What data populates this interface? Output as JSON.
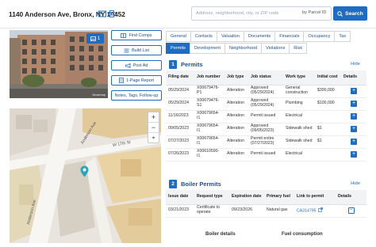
{
  "header": {
    "address": "1140 Anderson Ave, Bronx, NY 10452",
    "icons": [
      "envelope-icon",
      "printer-icon"
    ]
  },
  "search": {
    "placeholder": "Address, neighborhood, city, or ZIP code",
    "by_label": "by Parcel ID",
    "button_label": "Search"
  },
  "photo": {
    "count": "1",
    "caption": "Nearmap"
  },
  "actions": {
    "find_comps": "Find Comps",
    "build_list": "Build List",
    "post_ad": "Post Ad",
    "page_report": "1-Page Report",
    "notes": "Notes, Tags, Follow-up"
  },
  "map": {
    "streets": {
      "w170": "W 17th St",
      "anderson_upper": "Anderson Ave",
      "anderson_lower": "Anderson Ave"
    },
    "zoom_in": "+",
    "zoom_out": "−",
    "reset": "⌖"
  },
  "tabs": {
    "row1": [
      "General",
      "Contacts",
      "Valuation",
      "Documents",
      "Financials",
      "Occupancy",
      "Tax"
    ],
    "row2": [
      "Permits",
      "Development",
      "Neighborhood",
      "Violations",
      "Risk"
    ],
    "active": "Permits"
  },
  "permits": {
    "number": "1",
    "title": "Permits",
    "hide_label": "Hide",
    "columns": [
      "Filing date",
      "Job number",
      "Job type",
      "Job status",
      "Work type",
      "Initial cost",
      "Details"
    ],
    "rows": [
      [
        "05/29/2024",
        "X00679476-P1",
        "Alteration",
        "Approved (05/29/2024)",
        "General construction",
        "$300,000"
      ],
      [
        "05/29/2024",
        "X00679476-S1",
        "Alteration",
        "Approved (05/29/2024)",
        "Plumbing",
        "$100,000"
      ],
      [
        "11/16/2023",
        "X00679654-I1",
        "Alteration",
        "Permit issued",
        "Electrical",
        ""
      ],
      [
        "09/05/2023",
        "X00679654-I1",
        "Alteration",
        "Approved (09/05/2023)",
        "Sidewalk shed",
        "$1"
      ],
      [
        "07/27/2023",
        "X00679654-I1",
        "Alteration",
        "Permit entire (07/27/2023)",
        "Sidewalk shed",
        "$1"
      ],
      [
        "07/26/2023",
        "X00610590-I1",
        "Alteration",
        "Permit issued",
        "Electrical",
        ""
      ]
    ]
  },
  "boiler": {
    "number": "2",
    "title": "Boiler Permits",
    "hide_label": "Hide",
    "columns": [
      "Issue date",
      "Request type",
      "Expiration date",
      "Primary fuel",
      "Link to permit",
      "Details"
    ],
    "rows": [
      [
        "03/21/2023",
        "Certificate to operate",
        "09/23/2026",
        "Natural gas",
        "CA314795"
      ]
    ],
    "sub_left": "Boiler details",
    "sub_right": "Fuel consumption"
  },
  "colors": {
    "accent": "#1f6dc2",
    "tab_text": "#1f4f8a"
  }
}
